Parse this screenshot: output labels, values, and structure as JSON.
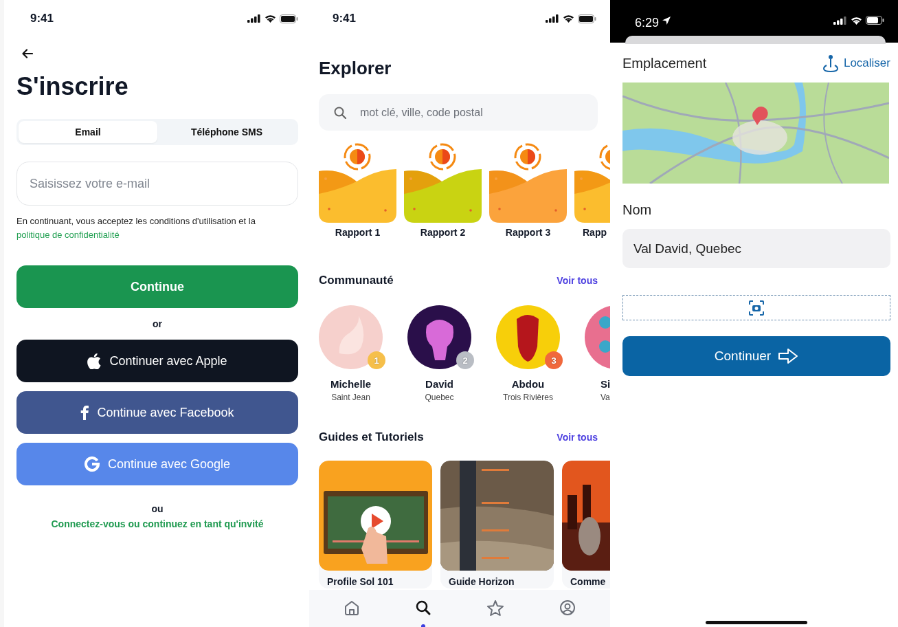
{
  "signup": {
    "status_time": "9:41",
    "title": "S'inscrire",
    "tabs": [
      {
        "label": "Email",
        "selected": true
      },
      {
        "label": "Téléphone SMS",
        "selected": false
      }
    ],
    "email_field": {
      "placeholder": "Saisissez votre e-mail"
    },
    "terms": "En continuant, vous acceptez les conditions d'utilisation et la",
    "privacy_link": "politique de confidentialité",
    "continue_button": "Continue",
    "or": "or",
    "social_buttons": [
      {
        "kind": "apple",
        "label": "Continuer avec Apple"
      },
      {
        "kind": "facebook",
        "label": "Continue avec Facebook"
      },
      {
        "kind": "google",
        "label": "Continue avec Google"
      }
    ],
    "ou": "ou",
    "guest_link": "Connectez-vous ou continuez en tant qu'invité"
  },
  "explorer": {
    "status_time": "9:41",
    "title": "Explorer",
    "search": {
      "placeholder": "mot clé, ville, code postal"
    },
    "reports": [
      {
        "label": "Rapport 1",
        "color": "#fbbd2e"
      },
      {
        "label": "Rapport 2",
        "color": "#c9d312"
      },
      {
        "label": "Rapport 3",
        "color": "#fba33c"
      },
      {
        "label": "Rapp",
        "color": "#fbbd2e"
      }
    ],
    "community": {
      "title": "Communauté",
      "see_all": "Voir tous",
      "members": [
        {
          "name": "Michelle",
          "city": "Saint Jean",
          "rank": "1",
          "color": "#f6bf4a"
        },
        {
          "name": "David",
          "city": "Quebec",
          "rank": "2",
          "color": "#b9bdc4"
        },
        {
          "name": "Abdou",
          "city": "Trois Rivières",
          "rank": "3",
          "color": "#f0683c"
        },
        {
          "name": "Si",
          "city": "Va"
        }
      ]
    },
    "guides": {
      "title": "Guides et Tutoriels",
      "see_all": "Voir tous",
      "items": [
        {
          "title": "Profile Sol 101"
        },
        {
          "title": "Guide Horizon"
        },
        {
          "title": "Comme"
        }
      ]
    },
    "nav": [
      {
        "kind": "home",
        "selected": false
      },
      {
        "kind": "search",
        "selected": true
      },
      {
        "kind": "star",
        "selected": false
      },
      {
        "kind": "profile",
        "selected": false
      }
    ]
  },
  "location": {
    "status_time": "6:29",
    "title": "Emplacement",
    "locate_button": "Localiser",
    "name_label": "Nom",
    "name_value": "Val David, Quebec",
    "continue_button": "Continuer"
  }
}
